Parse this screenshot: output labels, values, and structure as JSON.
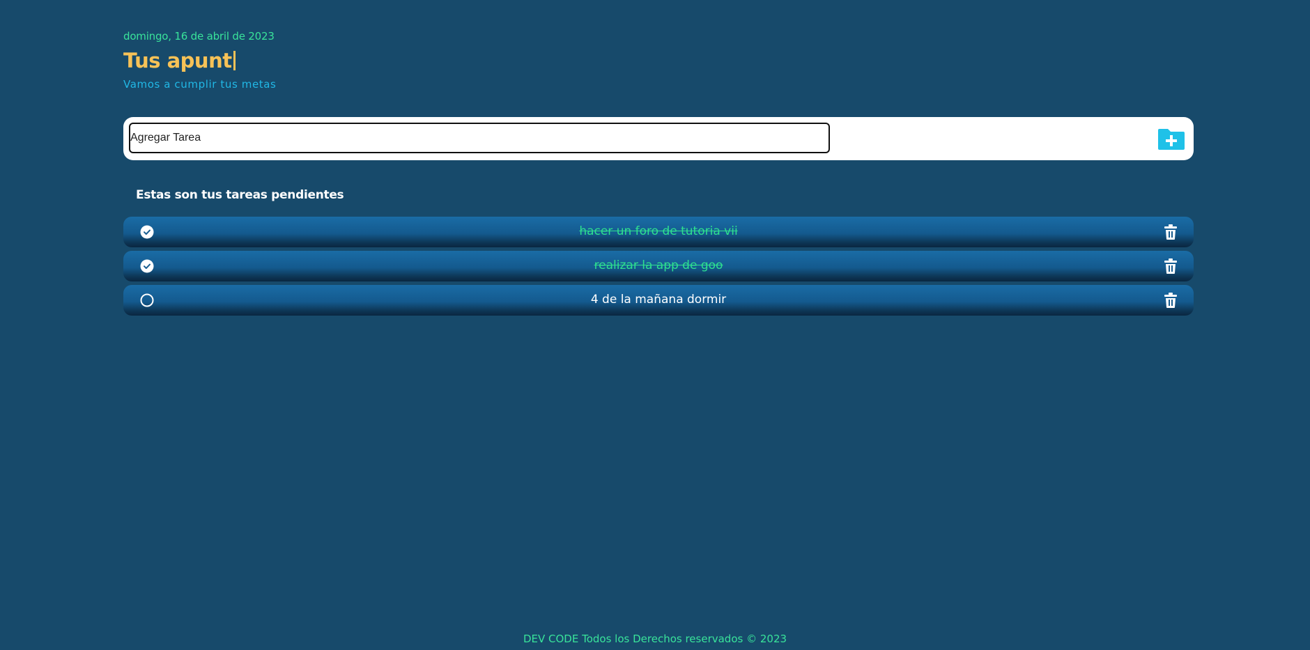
{
  "header": {
    "date": "domingo, 16 de abril de 2023",
    "title": "Tus apunt",
    "subtitle": "Vamos a cumplir tus metas"
  },
  "add_task": {
    "placeholder": "Agregar Tarea",
    "value": "",
    "button_icon": "folder-plus-icon"
  },
  "list": {
    "heading": "Estas son tus tareas pendientes",
    "tasks": [
      {
        "text": "hacer un foro de tutoria vii",
        "completed": true
      },
      {
        "text": "realizar la app de goo",
        "completed": true
      },
      {
        "text": "4 de la mañana dormir",
        "completed": false
      }
    ]
  },
  "footer": {
    "text": "DEV CODE Todos los Derechos reservados © 2023"
  },
  "colors": {
    "background": "#174a6b",
    "date": "#39e39a",
    "title": "#f7c257",
    "subtitle": "#21b8e6",
    "done_text": "#2ee08f",
    "accent_button": "#1fc1e8"
  }
}
